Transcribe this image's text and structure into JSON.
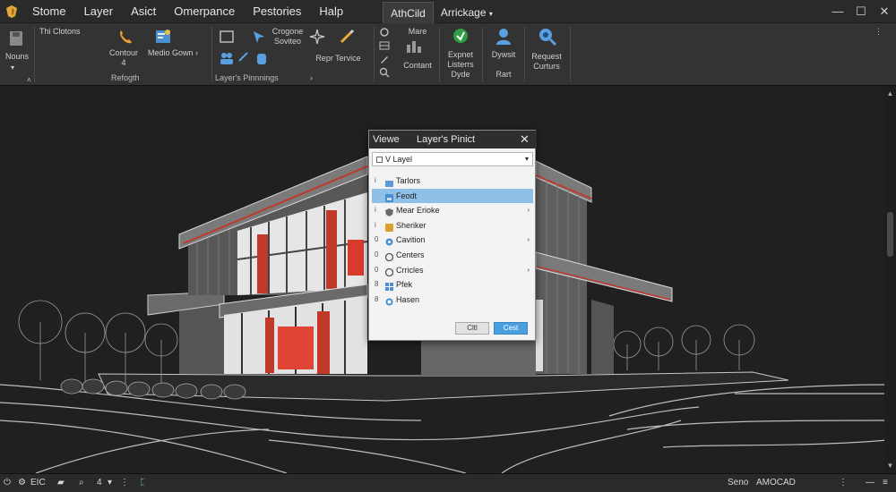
{
  "app": {
    "menu": [
      "Stome",
      "Layer",
      "Asict",
      "Omerpance",
      "Pestories",
      "Halp"
    ],
    "tabs": [
      {
        "label": "AthCild"
      },
      {
        "label": "Arrickage"
      }
    ],
    "active_tab": 0,
    "window_controls": [
      "minimize",
      "restore",
      "close"
    ],
    "accent_color": "#e3a93b"
  },
  "ribbon": {
    "nouns_label": "Nouns",
    "group1_title": "Thi Clotons",
    "contour_label": "Contour",
    "contour_sub": "4",
    "media_label": "Medio Gown",
    "group1_label": "Refogth",
    "create_label": "Crogone",
    "create_sub": "Soviteo",
    "repair_label": "Repr Tervice",
    "layers_label": "Layer's Pinnnings",
    "more_label": "Mare",
    "content_label": "Contant",
    "export_label": "Expnet",
    "export_sub": "Listerrs",
    "export_sub2": "Dyde",
    "export_color": "#2f9e44",
    "device_label": "Dywsit",
    "device_sub": "Rart",
    "request_label": "Request",
    "request_sub": "Curturs"
  },
  "dialog": {
    "title_left": "Viewe",
    "title_main": "Layer's Pinict",
    "close_glyph": "✕",
    "dropdown_value": "V Layel",
    "items": [
      {
        "mark": "i",
        "icon": "folder-icon",
        "label": "Tarlors",
        "submenu": false,
        "selected": false
      },
      {
        "mark": "",
        "icon": "image-icon",
        "label": "Feodt",
        "submenu": false,
        "selected": true
      },
      {
        "mark": "i",
        "icon": "shield-icon",
        "label": "Mear Erioke",
        "submenu": true,
        "selected": false
      },
      {
        "mark": "i",
        "icon": "layer-icon",
        "label": "Sheriker",
        "submenu": false,
        "selected": false
      },
      {
        "mark": "0",
        "icon": "gear-icon",
        "label": "Cavition",
        "submenu": true,
        "selected": false
      },
      {
        "mark": "0",
        "icon": "link-icon",
        "label": "Centers",
        "submenu": false,
        "selected": false
      },
      {
        "mark": "0",
        "icon": "link-icon",
        "label": "Crricles",
        "submenu": true,
        "selected": false
      },
      {
        "mark": "8",
        "icon": "grid-icon",
        "label": "Pfek",
        "submenu": false,
        "selected": false
      },
      {
        "mark": "8",
        "icon": "target-icon",
        "label": "Hasen",
        "submenu": false,
        "selected": false
      }
    ],
    "cancel_label": "Cltl",
    "ok_label": "Cest",
    "selected_color": "#8fc1e8"
  },
  "statusbar": {
    "left_items": [
      "EIC",
      "4"
    ],
    "right_items": [
      "Seno",
      "AMOCAD"
    ],
    "accent_color": "#6fd0d0"
  }
}
